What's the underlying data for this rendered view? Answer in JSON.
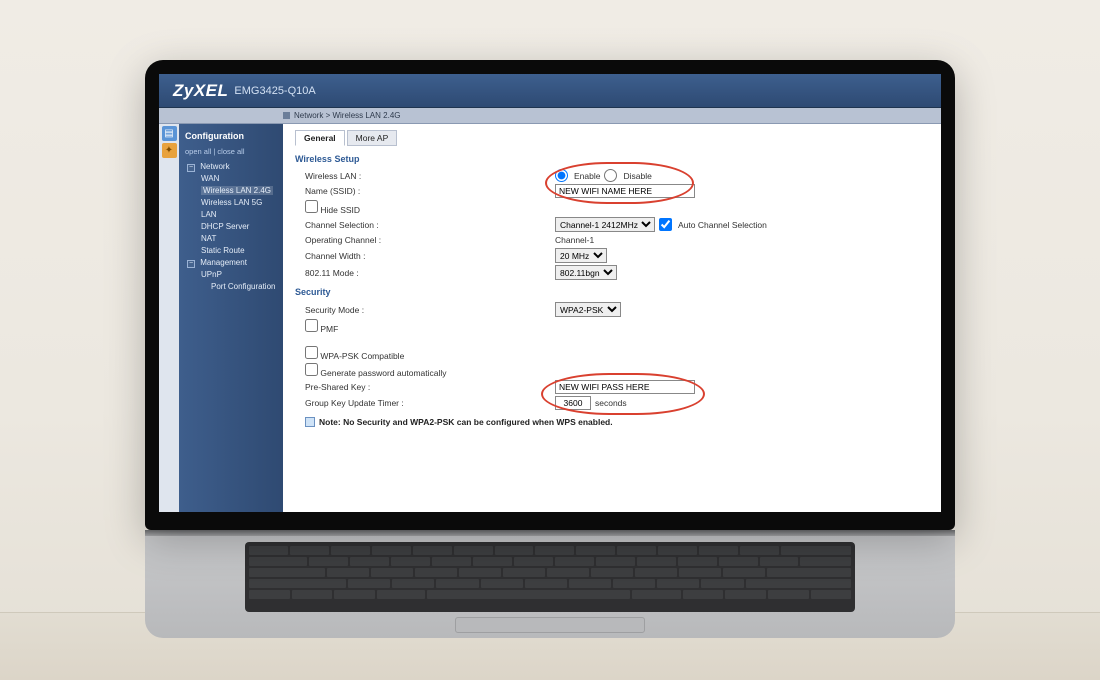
{
  "brand": "ZyXEL",
  "model": "EMG3425-Q10A",
  "breadcrumb": {
    "prefix": "Network",
    "current": "Wireless LAN 2.4G"
  },
  "sidebar": {
    "title": "Configuration",
    "open_all": "open all",
    "close_all": "close all",
    "network": {
      "label": "Network",
      "items": [
        "WAN",
        "Wireless LAN 2.4G",
        "Wireless LAN 5G",
        "LAN",
        "DHCP Server",
        "NAT",
        "Static Route"
      ]
    },
    "management": {
      "label": "Management",
      "items": [
        "UPnP",
        "Port Configuration"
      ]
    }
  },
  "tabs": {
    "general": "General",
    "more_ap": "More AP"
  },
  "wireless_setup": {
    "heading": "Wireless Setup",
    "wlan_label": "Wireless LAN :",
    "enable": "Enable",
    "disable": "Disable",
    "ssid_label": "Name (SSID) :",
    "ssid_value": "NEW WIFI NAME HERE",
    "hide_ssid": "Hide SSID",
    "channel_sel_label": "Channel Selection :",
    "channel_sel_value": "Channel-1 2412MHz",
    "auto_channel": "Auto Channel Selection",
    "op_channel_label": "Operating Channel :",
    "op_channel_value": "Channel-1",
    "chan_width_label": "Channel Width :",
    "chan_width_value": "20 MHz",
    "mode_label": "802.11 Mode :",
    "mode_value": "802.11bgn"
  },
  "security": {
    "heading": "Security",
    "mode_label": "Security Mode :",
    "mode_value": "WPA2-PSK",
    "pmf": "PMF",
    "wpa_compat": "WPA-PSK Compatible",
    "gen_auto": "Generate password automatically",
    "psk_label": "Pre-Shared Key :",
    "psk_value": "NEW WIFI PASS HERE",
    "timer_label": "Group Key Update Timer :",
    "timer_value": "3600",
    "timer_unit": "seconds"
  },
  "note": "Note: No Security and WPA2-PSK can be configured when WPS enabled."
}
